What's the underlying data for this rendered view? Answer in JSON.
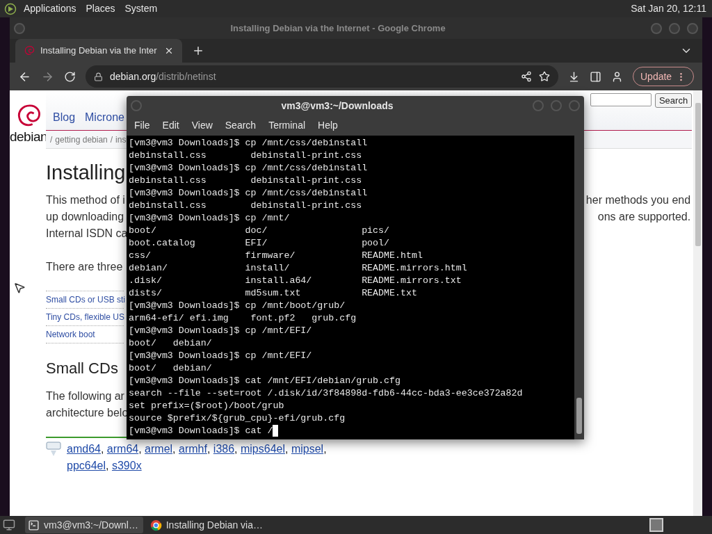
{
  "top_panel": {
    "menus": [
      "Applications",
      "Places",
      "System"
    ],
    "clock": "Sat Jan 20, 12:11"
  },
  "browser": {
    "title": "Installing Debian via the Internet - Google Chrome",
    "tabs": [
      {
        "label": "Installing Debian via the Inter",
        "selected": true
      }
    ],
    "url_host": "debian.org",
    "url_path": "/distrib/netinst",
    "update_label": "Update"
  },
  "page": {
    "logo_text": "debian",
    "nav": [
      "Blog",
      "Microne"
    ],
    "search_button": "Search",
    "breadcrumb": [
      {
        "sep": "/",
        "label": "getting debian"
      },
      {
        "sep": "/",
        "label": "ins"
      }
    ],
    "heading": "Installing",
    "intro_lines": [
      {
        "left": "This method of i",
        "right": "her methods you end"
      },
      {
        "left": "up downloading",
        "right": "ons are supported."
      },
      {
        "left": "Internal ISDN ca"
      }
    ],
    "paragraph": "There are three",
    "toc": [
      "Small CDs or USB sti",
      "Tiny CDs, flexible US",
      "Network boot"
    ],
    "subheading": "Small CDs",
    "following_lines": [
      "The following ar",
      "architecture belo"
    ],
    "arch_links": [
      {
        "label": "amd64",
        "sep": ","
      },
      {
        "label": "arm64",
        "sep": ","
      },
      {
        "label": "armel",
        "sep": ","
      },
      {
        "label": "armhf",
        "sep": ","
      },
      {
        "label": "i386",
        "sep": ","
      },
      {
        "label": "mips64el",
        "sep": ","
      },
      {
        "label": "mipsel",
        "sep": ","
      },
      {
        "label": "ppc64el",
        "sep": ","
      },
      {
        "label": "s390x"
      }
    ]
  },
  "terminal": {
    "title": "vm3@vm3:~/Downloads",
    "menus": [
      "File",
      "Edit",
      "View",
      "Search",
      "Terminal",
      "Help"
    ],
    "lines": [
      "[vm3@vm3 Downloads]$ cp /mnt/css/debinstall",
      "debinstall.css        debinstall-print.css",
      "[vm3@vm3 Downloads]$ cp /mnt/css/debinstall",
      "debinstall.css        debinstall-print.css",
      "[vm3@vm3 Downloads]$ cp /mnt/css/debinstall",
      "debinstall.css        debinstall-print.css",
      "[vm3@vm3 Downloads]$ cp /mnt/",
      "boot/                doc/                 pics/",
      "boot.catalog         EFI/                 pool/",
      "css/                 firmware/            README.html",
      "debian/              install/             README.mirrors.html",
      ".disk/               install.a64/         README.mirrors.txt",
      "dists/               md5sum.txt           README.txt",
      "[vm3@vm3 Downloads]$ cp /mnt/boot/grub/",
      "arm64-efi/ efi.img    font.pf2   grub.cfg",
      "[vm3@vm3 Downloads]$ cp /mnt/EFI/",
      "boot/   debian/",
      "[vm3@vm3 Downloads]$ cp /mnt/EFI/",
      "boot/   debian/",
      "[vm3@vm3 Downloads]$ cat /mnt/EFI/debian/grub.cfg",
      "search --file --set=root /.disk/id/3f84898d-fdb6-44cc-bda3-ee3ce372a82d",
      "set prefix=($root)/boot/grub",
      "source $prefix/${grub_cpu}-efi/grub.cfg",
      "[vm3@vm3 Downloads]$ cat /"
    ],
    "cursor_visible": true
  },
  "taskbar": {
    "items": [
      {
        "kind": "terminal",
        "label": "vm3@vm3:~/Downl…",
        "selected": true
      },
      {
        "kind": "browser",
        "label": "Installing Debian via…",
        "selected": false
      }
    ]
  }
}
